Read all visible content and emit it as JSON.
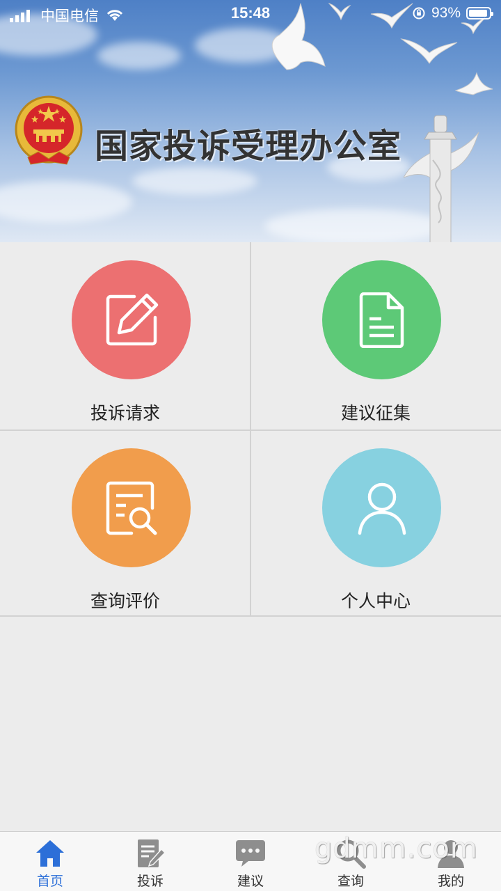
{
  "status_bar": {
    "carrier": "中国电信",
    "time": "15:48",
    "battery_text": "93%",
    "battery_level": 0.93
  },
  "banner": {
    "title": "国家投诉受理办公室"
  },
  "menu": {
    "items": [
      {
        "label": "投诉请求",
        "icon": "edit-icon",
        "color": "#ec7071"
      },
      {
        "label": "建议征集",
        "icon": "document-icon",
        "color": "#5dc977"
      },
      {
        "label": "查询评价",
        "icon": "search-document-icon",
        "color": "#f19d4c"
      },
      {
        "label": "个人中心",
        "icon": "user-icon",
        "color": "#87d1e0"
      }
    ]
  },
  "tabbar": {
    "items": [
      {
        "label": "首页",
        "icon": "home-icon",
        "active": true
      },
      {
        "label": "投诉",
        "icon": "complaint-icon",
        "active": false
      },
      {
        "label": "建议",
        "icon": "chat-icon",
        "active": false
      },
      {
        "label": "查询",
        "icon": "search-icon",
        "active": false
      },
      {
        "label": "我的",
        "icon": "profile-icon",
        "active": false
      }
    ],
    "active_color": "#2c6fd8",
    "inactive_color": "#8e8e8e"
  },
  "watermark": "gdmm.com"
}
